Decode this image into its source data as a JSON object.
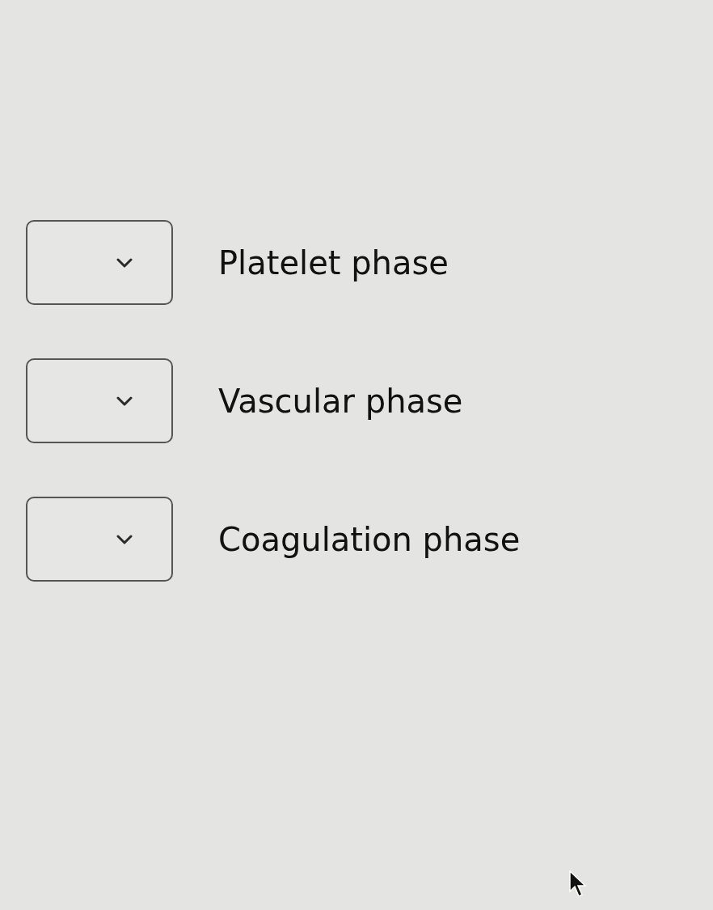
{
  "items": [
    {
      "label": "Platelet phase"
    },
    {
      "label": "Vascular phase"
    },
    {
      "label": "Coagulation phase"
    }
  ]
}
